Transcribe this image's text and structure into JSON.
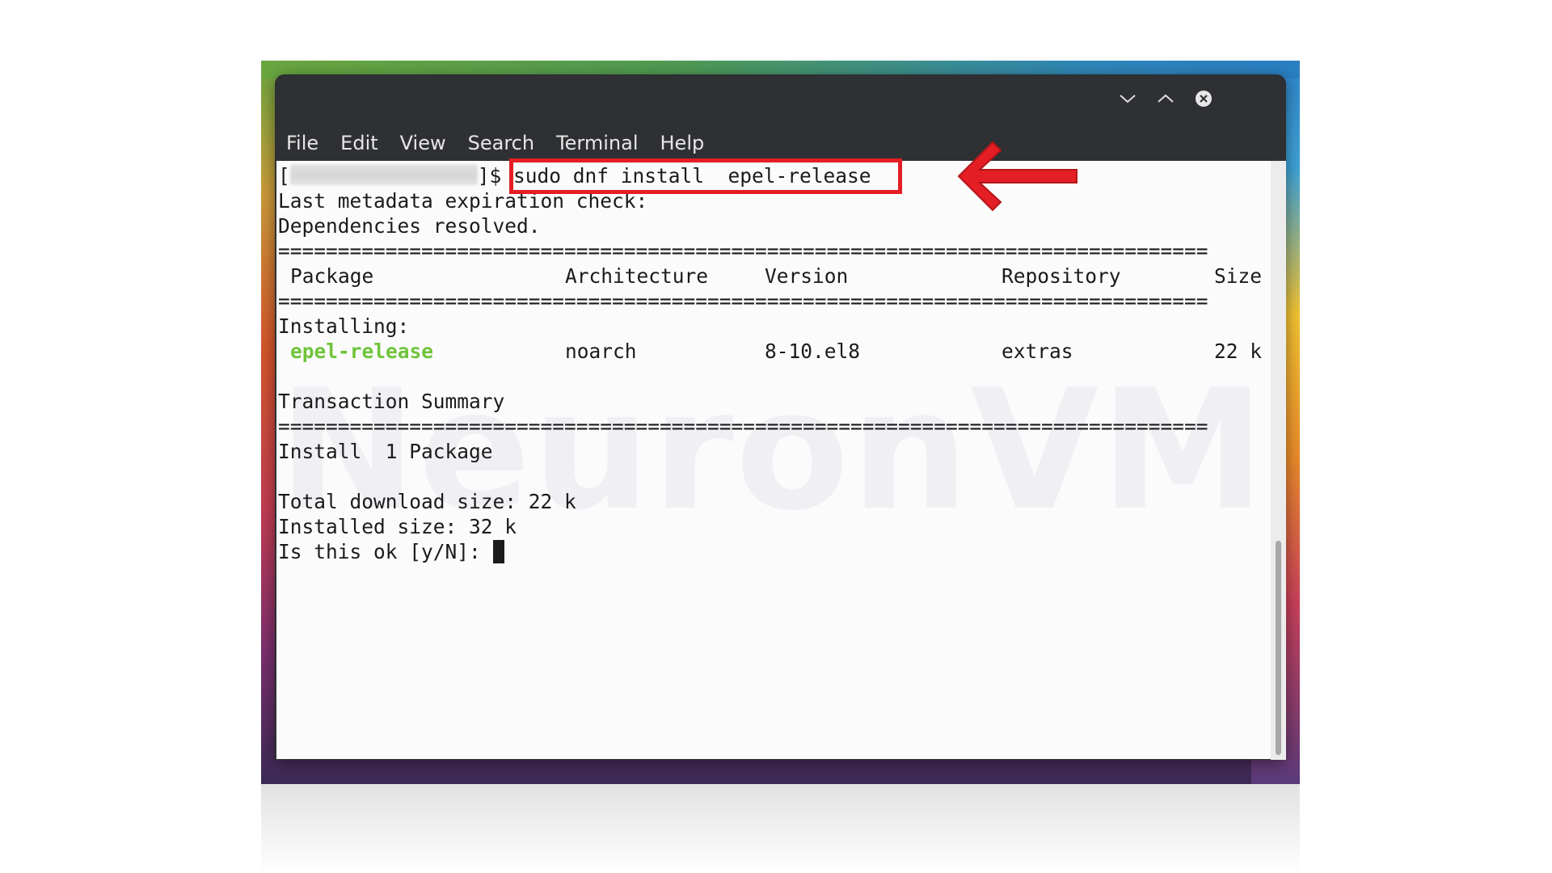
{
  "menu": {
    "items": [
      "File",
      "Edit",
      "View",
      "Search",
      "Terminal",
      "Help"
    ]
  },
  "window_controls": {
    "minimize_icon": "chevron-down-icon",
    "maximize_icon": "chevron-up-icon",
    "close_icon": "close-icon"
  },
  "terminal": {
    "prompt_open": "[",
    "prompt_close": "]$ ",
    "command": "sudo dnf install  epel-release",
    "metadata_line": "Last metadata expiration check:",
    "deps_line": "Dependencies resolved.",
    "separator": "==============================================================================",
    "table_headers": [
      "Package",
      "Architecture",
      "Version",
      "Repository",
      "Size"
    ],
    "installing_label": "Installing:",
    "package": {
      "name": "epel-release",
      "arch": "noarch",
      "version": "8-10.el8",
      "repo": "extras",
      "size": "22 k"
    },
    "summary_title": "Transaction Summary",
    "install_count": "Install  1 Package",
    "total_download": "Total download size: 22 k",
    "installed_size": "Installed size: 32 k",
    "confirm_prompt": "Is this ok [y/N]: "
  },
  "watermark": "NeuronVM",
  "colors": {
    "highlight": "#e31e24",
    "package_name": "#6fc43a",
    "titlebar": "#2e3033"
  }
}
